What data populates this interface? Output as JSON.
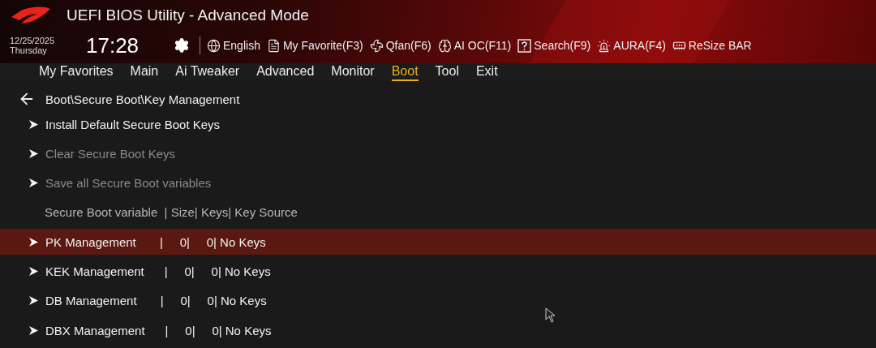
{
  "header": {
    "title": "UEFI BIOS Utility - Advanced Mode",
    "date": "12/25/2025",
    "weekday": "Thursday",
    "time": "17:28",
    "tools": [
      {
        "kind": "language",
        "label": "English"
      },
      {
        "kind": "favorite",
        "label": "My Favorite(F3)"
      },
      {
        "kind": "qfan",
        "label": "Qfan(F6)"
      },
      {
        "kind": "aioc",
        "label": "AI OC(F11)"
      },
      {
        "kind": "search",
        "label": "Search(F9)"
      },
      {
        "kind": "aura",
        "label": "AURA(F4)"
      },
      {
        "kind": "resizebar",
        "label": "ReSize BAR"
      }
    ]
  },
  "tabs": [
    {
      "label": "My Favorites",
      "selected": false
    },
    {
      "label": "Main",
      "selected": false
    },
    {
      "label": "Ai Tweaker",
      "selected": false
    },
    {
      "label": "Advanced",
      "selected": false
    },
    {
      "label": "Monitor",
      "selected": false
    },
    {
      "label": "Boot",
      "selected": true
    },
    {
      "label": "Tool",
      "selected": false
    },
    {
      "label": "Exit",
      "selected": false
    }
  ],
  "breadcrumb": "Boot\\Secure Boot\\Key Management",
  "items": [
    {
      "kind": "submenu",
      "label": "Install Default Secure Boot Keys",
      "disabled": false,
      "selected": false
    },
    {
      "kind": "submenu",
      "label": "Clear Secure Boot Keys",
      "disabled": true,
      "selected": false
    },
    {
      "kind": "submenu",
      "label": "Save all Secure Boot variables",
      "disabled": true,
      "selected": false
    },
    {
      "kind": "heading",
      "label": "Secure Boot variable  | Size| Keys| Key Source"
    },
    {
      "kind": "submenu",
      "label": "PK Management       |     0|     0| No Keys",
      "disabled": false,
      "selected": true
    },
    {
      "kind": "submenu",
      "label": "KEK Management      |     0|     0| No Keys",
      "disabled": false,
      "selected": false
    },
    {
      "kind": "submenu",
      "label": "DB Management       |     0|     0| No Keys",
      "disabled": false,
      "selected": false
    },
    {
      "kind": "submenu",
      "label": "DBX Management      |     0|     0| No Keys",
      "disabled": false,
      "selected": false
    }
  ]
}
